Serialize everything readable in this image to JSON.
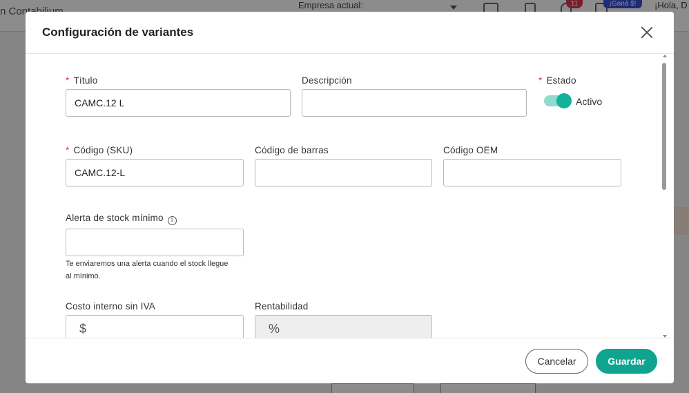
{
  "background": {
    "brand_text": "n Contabilium",
    "company_label": "Empresa actual:",
    "notifications_count": "11",
    "promo_label": "¡Ganá $!",
    "greeting": "¡Hola, D"
  },
  "modal": {
    "title": "Configuración de variantes",
    "fields": {
      "titulo": {
        "label": "Título",
        "required": true,
        "value": "CAMC.12 L"
      },
      "descripcion": {
        "label": "Descripción",
        "value": ""
      },
      "estado": {
        "label": "Estado",
        "required": true,
        "toggle_label": "Activo",
        "on": true
      },
      "codigo_sku": {
        "label": "Código (SKU)",
        "required": true,
        "value": "CAMC.12-L"
      },
      "codigo_barras": {
        "label": "Código de barras",
        "value": ""
      },
      "codigo_oem": {
        "label": "Código OEM",
        "value": ""
      },
      "alerta_stock": {
        "label": "Alerta de stock mínimo",
        "value": "",
        "hint": "Te enviaremos una alerta cuando el stock llegue al mínimo."
      },
      "costo_interno": {
        "label": "Costo interno sin IVA",
        "prefix": "$",
        "value": ""
      },
      "rentabilidad": {
        "label": "Rentabilidad",
        "prefix": "%",
        "value": ""
      }
    },
    "footer": {
      "cancel_label": "Cancelar",
      "save_label": "Guardar"
    }
  },
  "colors": {
    "primary": "#0fa48f",
    "toggle_track": "#8ddccc",
    "required": "#e0394a"
  }
}
